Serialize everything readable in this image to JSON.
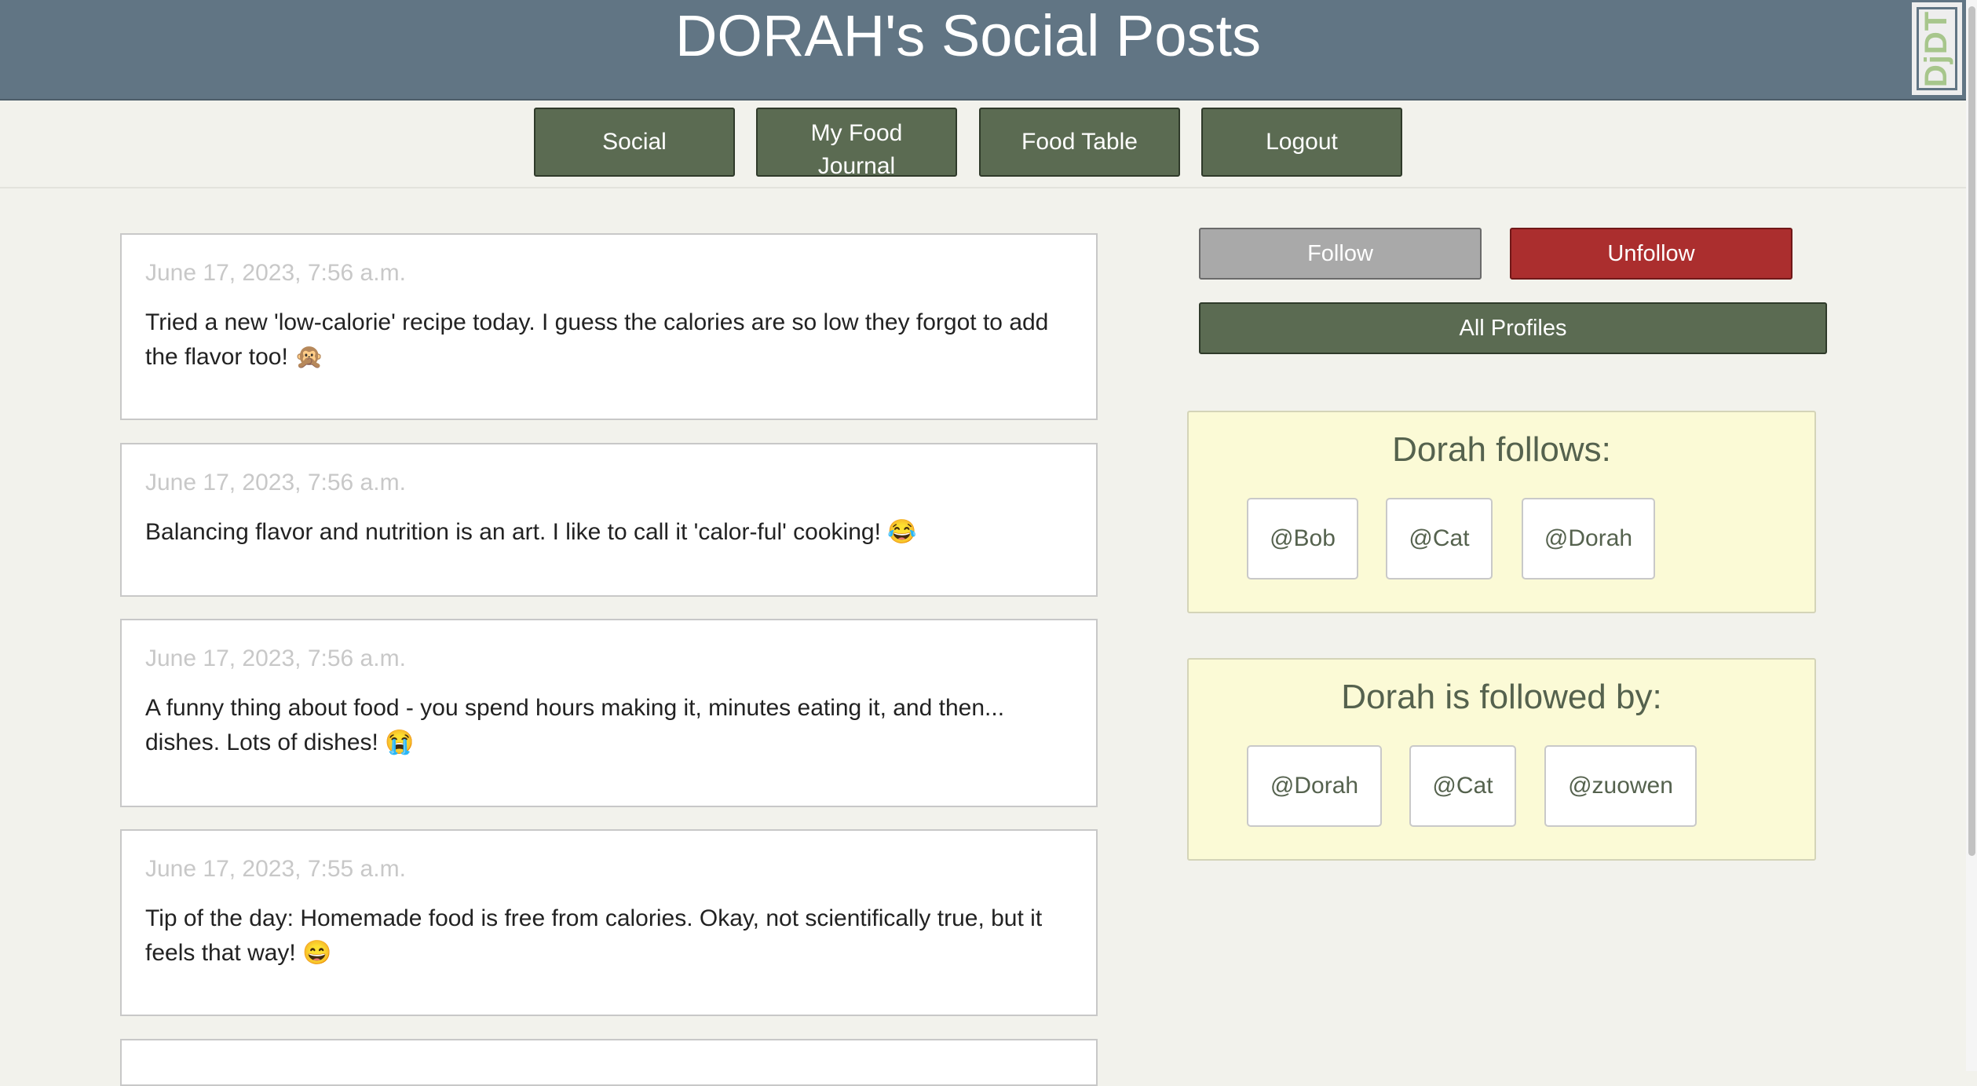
{
  "header": {
    "title": "DORAH's Social Posts",
    "toolbar_badge": "DjDT"
  },
  "nav": {
    "social": "Social",
    "journal": "My Food Journal",
    "food_table": "Food Table",
    "logout": "Logout"
  },
  "posts": [
    {
      "date": "June 17, 2023, 7:56 a.m.",
      "text": "Tried a new 'low-calorie' recipe today. I guess the calories are so low they forgot to add the flavor too! 🙊"
    },
    {
      "date": "June 17, 2023, 7:56 a.m.",
      "text": "Balancing flavor and nutrition is an art. I like to call it 'calor-ful' cooking! 😂"
    },
    {
      "date": "June 17, 2023, 7:56 a.m.",
      "text": "A funny thing about food - you spend hours making it, minutes eating it, and then... dishes. Lots of dishes! 😭"
    },
    {
      "date": "June 17, 2023, 7:55 a.m.",
      "text": "Tip of the day: Homemade food is free from calories. Okay, not scientifically true, but it feels that way! 😄"
    }
  ],
  "sidebar": {
    "follow": "Follow",
    "unfollow": "Unfollow",
    "all_profiles": "All Profiles",
    "follows": {
      "title": "Dorah follows:",
      "users": [
        "@Bob",
        "@Cat",
        "@Dorah"
      ]
    },
    "followed_by": {
      "title": "Dorah is followed by:",
      "users": [
        "@Dorah",
        "@Cat",
        "@zuowen"
      ]
    }
  },
  "colors": {
    "header": "#617584",
    "nav_button": "#5b6b52",
    "unfollow": "#ab2e2e",
    "follow": "#a9a9a9",
    "box": "#fbfad6"
  }
}
